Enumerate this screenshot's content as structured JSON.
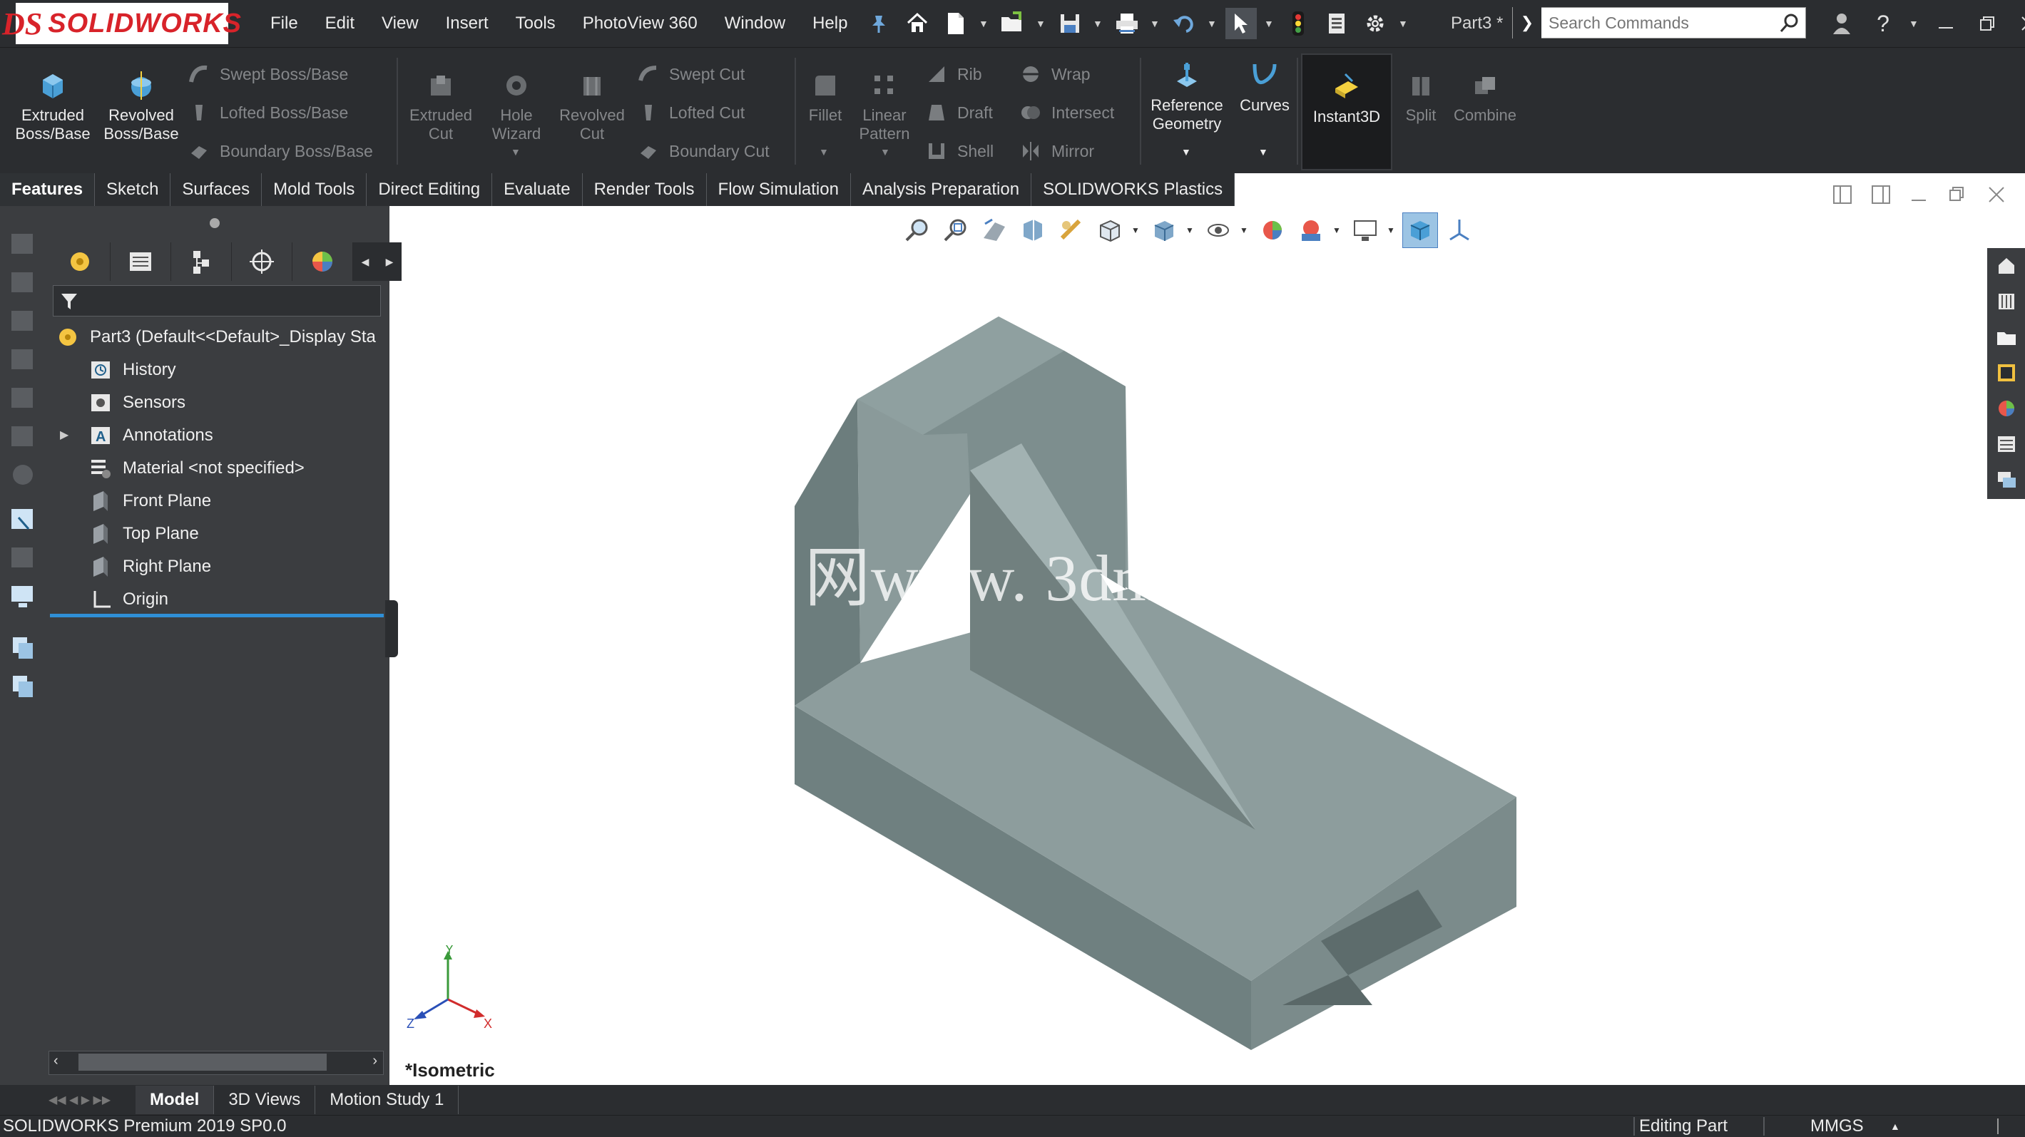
{
  "app": {
    "brand_prefix": "DS",
    "brand": "SOLIDWORKS",
    "document_title": "Part3 *"
  },
  "menu": [
    "File",
    "Edit",
    "View",
    "Insert",
    "Tools",
    "PhotoView 360",
    "Window",
    "Help"
  ],
  "search": {
    "placeholder": "Search Commands"
  },
  "command_manager": {
    "extruded_boss": "Extruded\nBoss/Base",
    "revolved_boss": "Revolved\nBoss/Base",
    "swept_boss": "Swept Boss/Base",
    "lofted_boss": "Lofted Boss/Base",
    "boundary_boss": "Boundary Boss/Base",
    "extruded_cut": "Extruded\nCut",
    "hole_wizard": "Hole\nWizard",
    "revolved_cut": "Revolved\nCut",
    "swept_cut": "Swept Cut",
    "lofted_cut": "Lofted Cut",
    "boundary_cut": "Boundary Cut",
    "fillet": "Fillet",
    "linear_pattern": "Linear\nPattern",
    "rib": "Rib",
    "draft": "Draft",
    "shell": "Shell",
    "wrap": "Wrap",
    "intersect": "Intersect",
    "mirror": "Mirror",
    "reference_geometry": "Reference\nGeometry",
    "curves": "Curves",
    "instant3d": "Instant3D",
    "split": "Split",
    "combine": "Combine"
  },
  "tabs": [
    "Features",
    "Sketch",
    "Surfaces",
    "Mold Tools",
    "Direct Editing",
    "Evaluate",
    "Render Tools",
    "Flow Simulation",
    "Analysis Preparation",
    "SOLIDWORKS Plastics"
  ],
  "active_tab": "Features",
  "feature_tree": {
    "root": "Part3  (Default<<Default>_Display Sta",
    "items": [
      "History",
      "Sensors",
      "Annotations",
      "Material <not specified>",
      "Front Plane",
      "Top Plane",
      "Right Plane",
      "Origin"
    ]
  },
  "graphics": {
    "view_label": "*Isometric",
    "triad": {
      "x": "X",
      "y": "Y",
      "z": "Z"
    },
    "watermark": "网www. 3dm",
    "model_color": "#7a8c8c"
  },
  "bottom_tabs": [
    "Model",
    "3D Views",
    "Motion Study 1"
  ],
  "active_bottom_tab": "Model",
  "status": {
    "product": "SOLIDWORKS Premium 2019 SP0.0",
    "mode": "Editing Part",
    "units": "MMGS"
  },
  "colors": {
    "chrome_dark": "#2b2d30",
    "panel": "#3b3d40",
    "brand_red": "#d8232a",
    "accent_blue": "#2f8fd6"
  }
}
